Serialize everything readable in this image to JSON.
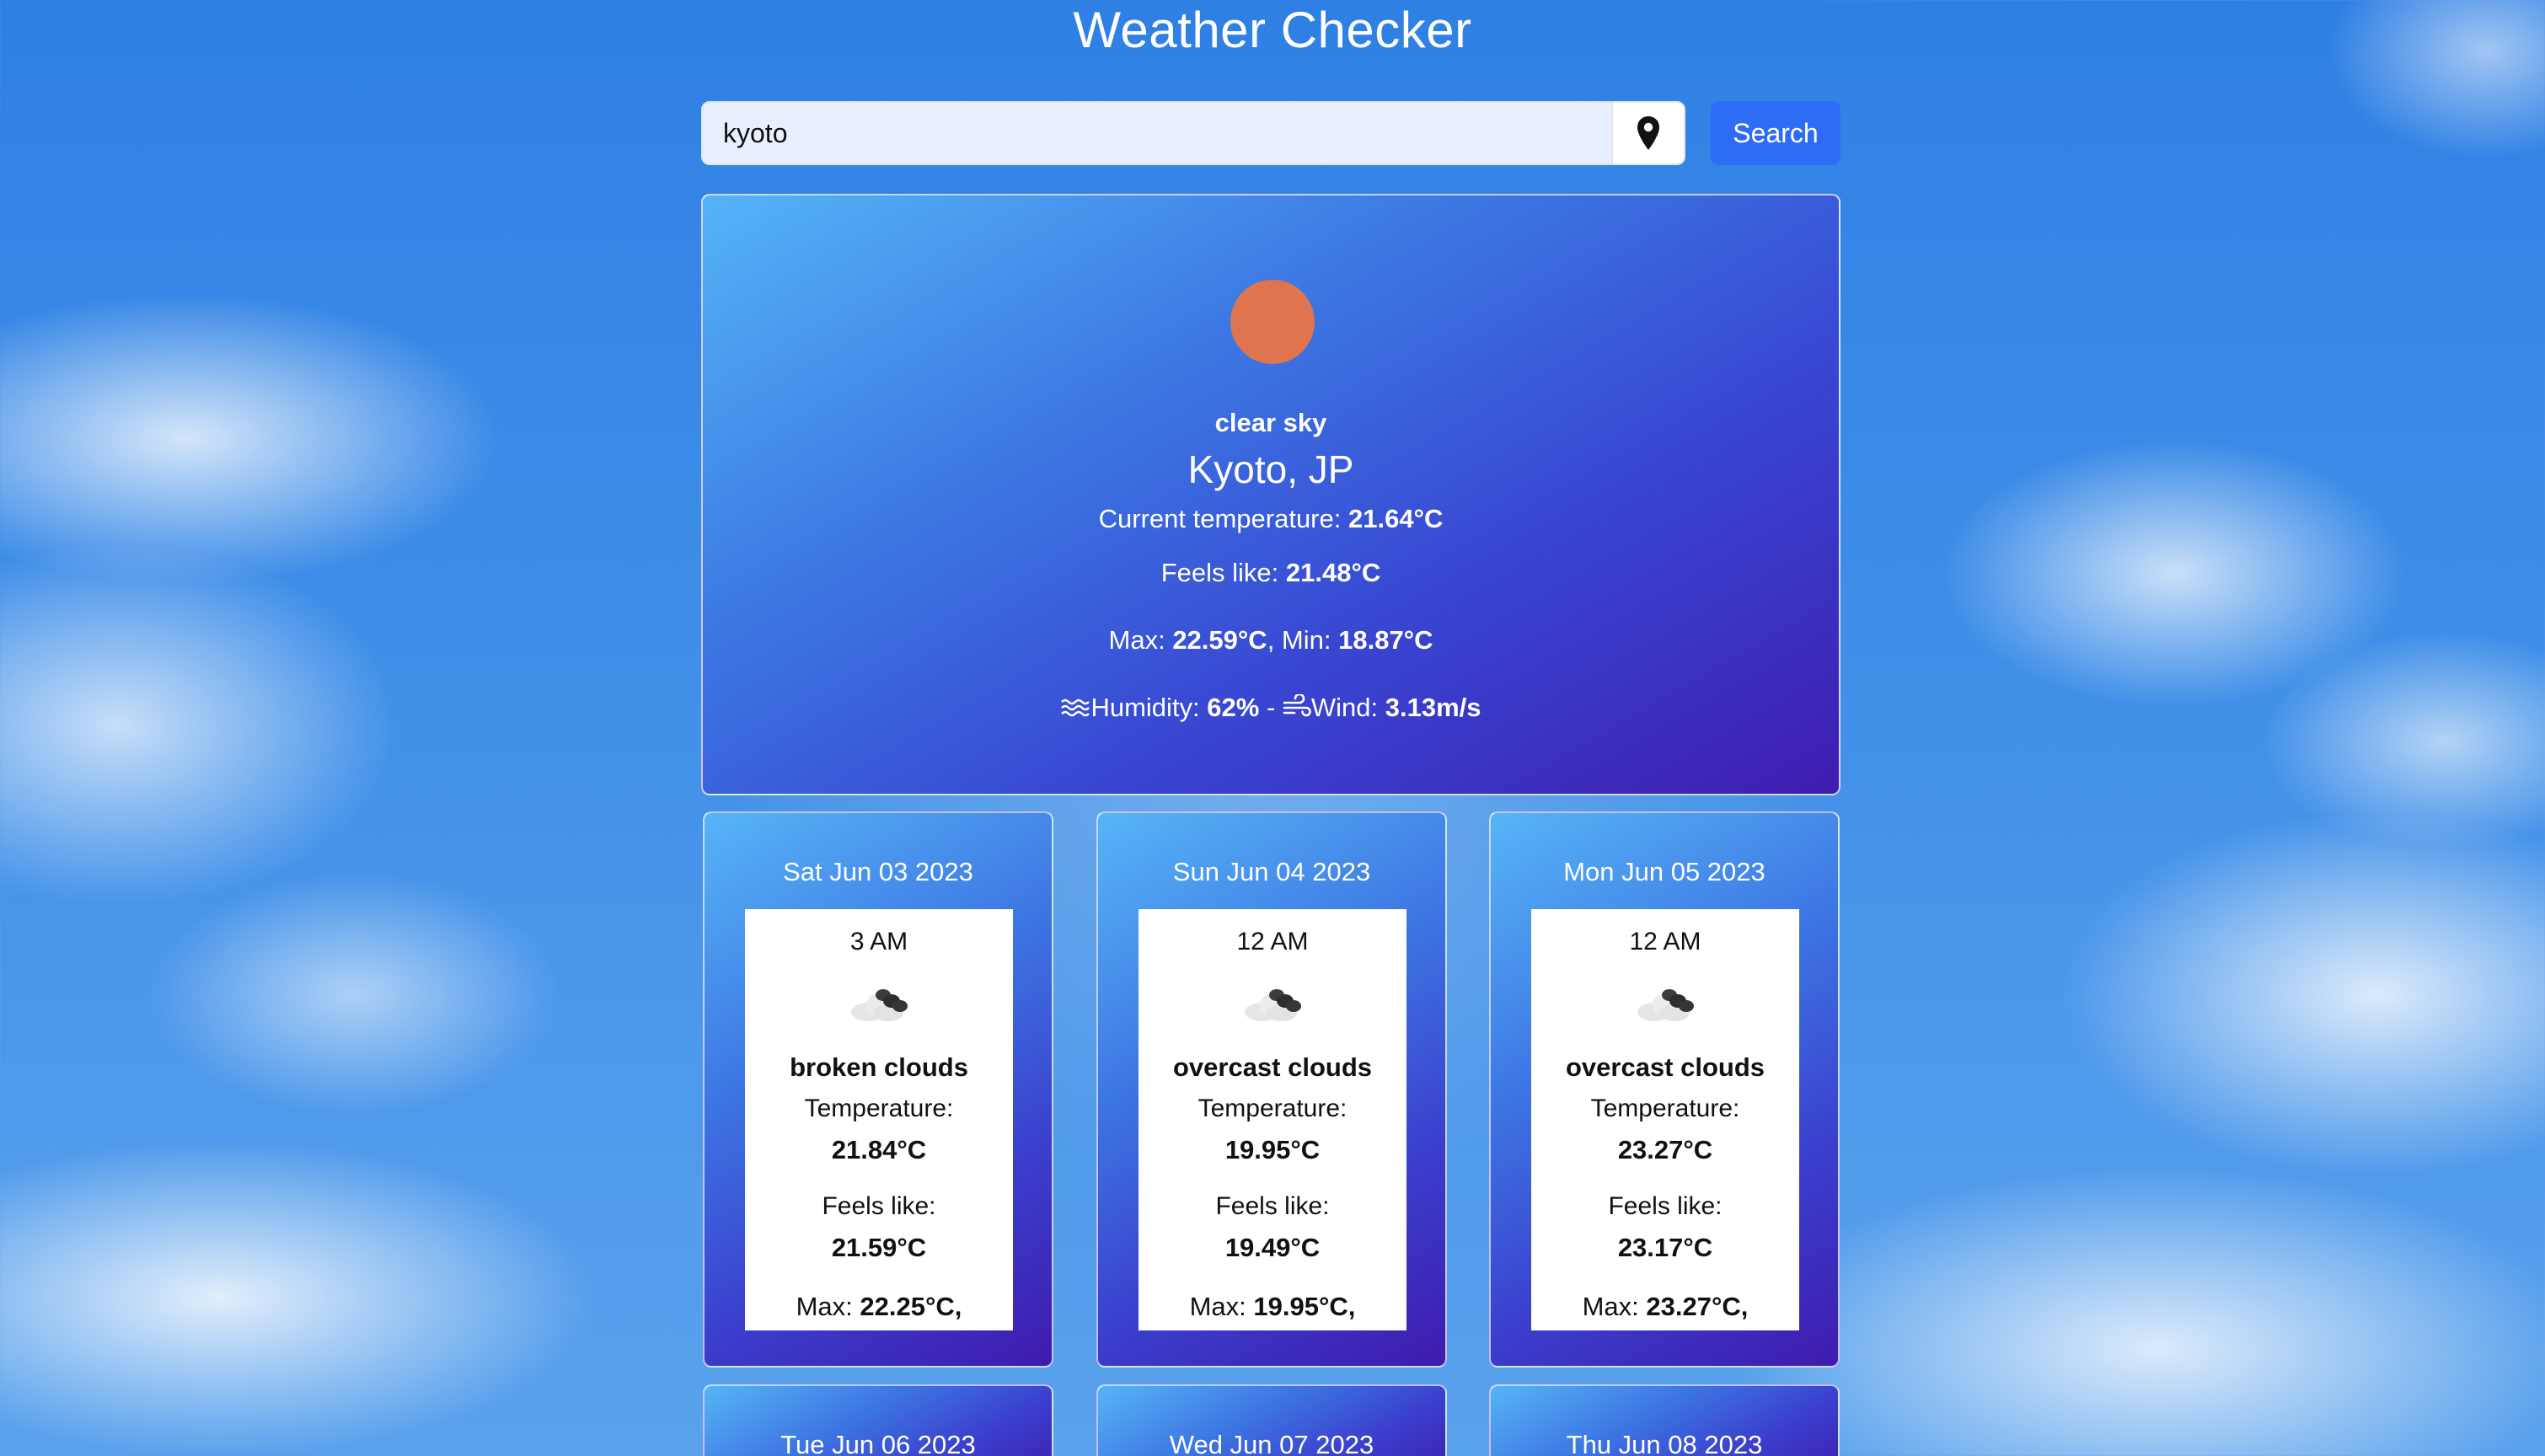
{
  "app": {
    "title": "Weather Checker"
  },
  "search": {
    "value": "kyoto",
    "button_label": "Search",
    "location_icon": "map-pin-icon"
  },
  "current": {
    "icon": "sun-icon",
    "icon_color": "#e0744f",
    "description": "clear sky",
    "city": "Kyoto, JP",
    "temp_label": "Current temperature:",
    "temp": "21.64°C",
    "feels_label": "Feels like:",
    "feels": "21.48°C",
    "max_label": "Max:",
    "max": "22.59°C",
    "min_label": ", Min:",
    "min": "18.87°C",
    "humidity_label": "Humidity:",
    "humidity": "62%",
    "separator": " - ",
    "wind_label": "Wind:",
    "wind": "3.13m/s"
  },
  "forecast": [
    {
      "date": "Sat Jun 03 2023",
      "time": "3 AM",
      "icon": "broken-clouds-icon",
      "description": "broken clouds",
      "temp_label": "Temperature:",
      "temp": "21.84°C",
      "feels_label": "Feels like:",
      "feels": "21.59°C",
      "max_label": "Max:",
      "max": "22.25°C,"
    },
    {
      "date": "Sun Jun 04 2023",
      "time": "12 AM",
      "icon": "overcast-clouds-icon",
      "description": "overcast clouds",
      "temp_label": "Temperature:",
      "temp": "19.95°C",
      "feels_label": "Feels like:",
      "feels": "19.49°C",
      "max_label": "Max:",
      "max": "19.95°C,"
    },
    {
      "date": "Mon Jun 05 2023",
      "time": "12 AM",
      "icon": "overcast-clouds-icon",
      "description": "overcast clouds",
      "temp_label": "Temperature:",
      "temp": "23.27°C",
      "feels_label": "Feels like:",
      "feels": "23.17°C",
      "max_label": "Max:",
      "max": "23.27°C,"
    },
    {
      "date": "Tue Jun 06 2023"
    },
    {
      "date": "Wed Jun 07 2023"
    },
    {
      "date": "Thu Jun 08 2023"
    }
  ],
  "colors": {
    "accent": "#2f6cf5",
    "card_gradient_start": "#55b4f7",
    "card_gradient_end": "#3f1cb0"
  }
}
